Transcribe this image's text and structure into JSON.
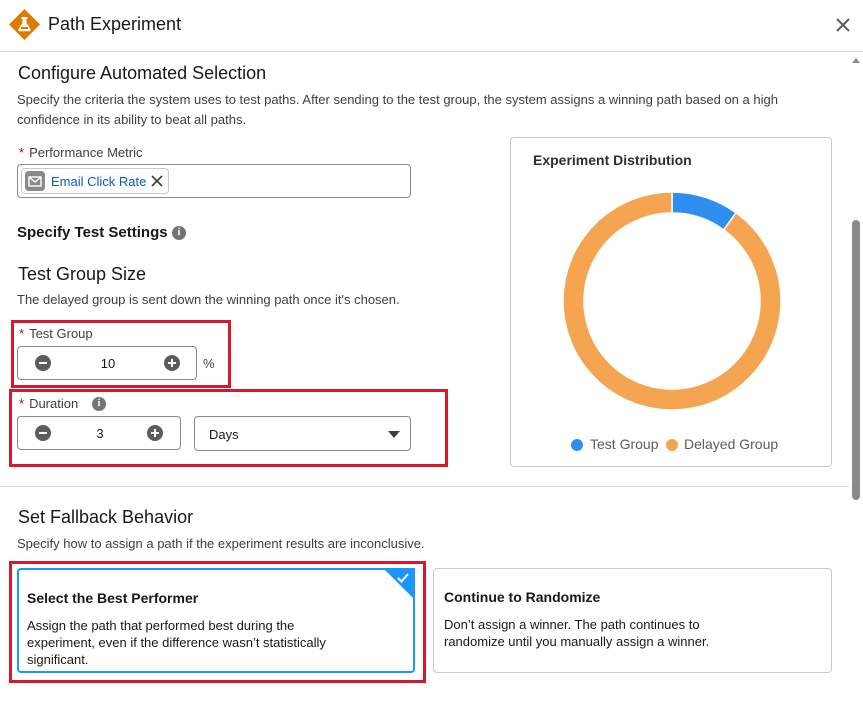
{
  "header": {
    "title": "Path Experiment",
    "app_icon": "flask-icon",
    "close_icon": "close-icon"
  },
  "automated": {
    "title": "Configure Automated Selection",
    "description_line1": "Specify the criteria the system uses to test paths. After sending to the test group, the system assigns a winning path based on a high",
    "description_line2": "confidence in its ability to beat all paths.",
    "metric_label": "Performance Metric",
    "required_mark": "*",
    "metric_pill": "Email Click Rate"
  },
  "test_settings": {
    "title": "Specify Test Settings",
    "info_glyph": "i"
  },
  "group_size": {
    "title": "Test Group Size",
    "description": "The delayed group is sent down the winning path once it's chosen.",
    "test_group_label": "Test Group",
    "test_group_value": "10",
    "test_group_unit": "%",
    "duration_label": "Duration",
    "duration_value": "3",
    "duration_unit": "Days"
  },
  "chart_data": {
    "type": "pie",
    "title": "Experiment Distribution",
    "donut": true,
    "categories": [
      "Test Group",
      "Delayed Group"
    ],
    "values": [
      10,
      90
    ],
    "colors": [
      "#2e8ef0",
      "#f5a551"
    ],
    "legend_position": "bottom"
  },
  "fallback": {
    "title": "Set Fallback Behavior",
    "description": "Specify how to assign a path if the experiment results are inconclusive.",
    "options": [
      {
        "title": "Select the Best Performer",
        "desc_line1": "Assign the path that performed best during the",
        "desc_line2": "experiment, even if the difference wasn’t statistically",
        "desc_line3": "significant.",
        "selected": true
      },
      {
        "title": "Continue to Randomize",
        "desc_line1": "Don’t assign a winner. The path continues to",
        "desc_line2": "randomize until you manually assign a winner.",
        "desc_line3": "",
        "selected": false
      }
    ]
  },
  "colors": {
    "accent": "#1b96ff",
    "highlight_box": "#d6192b",
    "app_icon": "#dd7a01"
  }
}
